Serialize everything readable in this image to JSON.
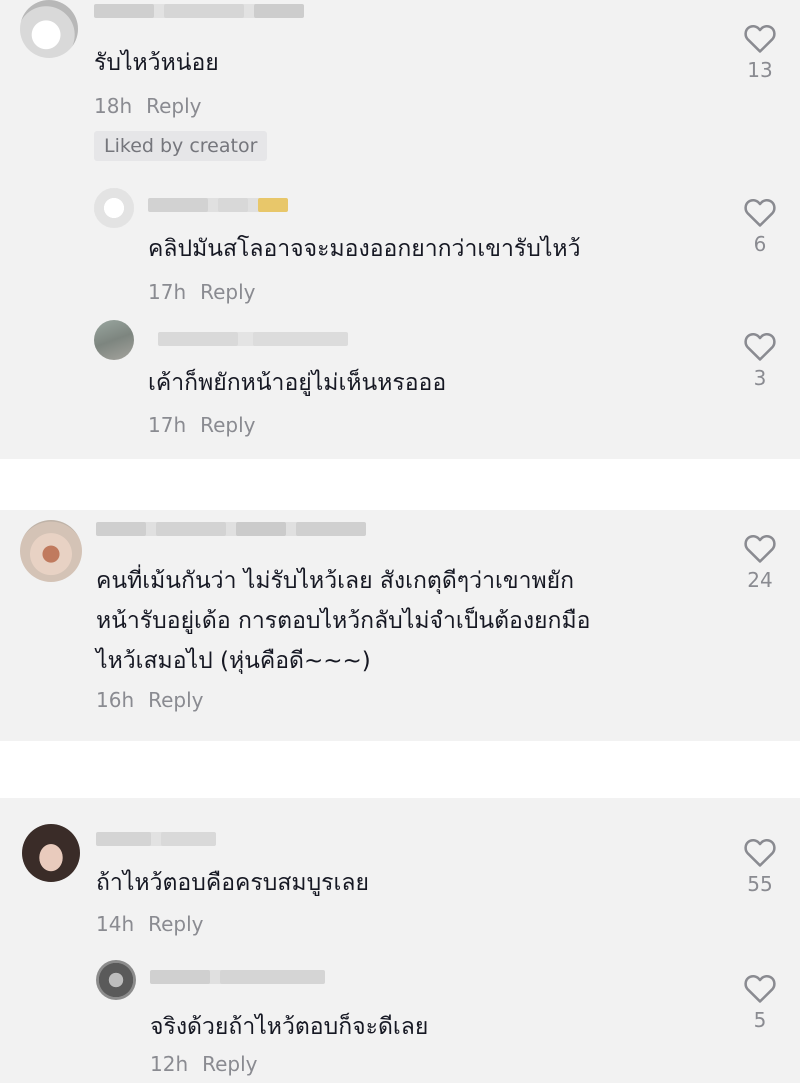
{
  "thread1": {
    "comment": {
      "text": "รับไหว้หน่อย",
      "time": "18h",
      "reply": "Reply",
      "likes": "13",
      "liked_badge": "Liked by creator"
    },
    "replies": [
      {
        "text": "คลิปมันสโลอาจจะมองออกยากว่าเขารับไหว้",
        "time": "17h",
        "reply": "Reply",
        "likes": "6"
      },
      {
        "text": "เค้าก็พยักหน้าอยู่ไม่เห็นหรอออ",
        "time": "17h",
        "reply": "Reply",
        "likes": "3"
      }
    ]
  },
  "thread2": {
    "comment": {
      "lines": [
        "คนที่เม้นกันว่า ไม่รับไหว้เลย สังเกตุดีๆว่าเขาพยัก",
        "หน้ารับอยู่เด้อ การตอบไหว้กลับไม่จำเป็นต้องยกมือ",
        "ไหว้เสมอไป (หุ่นคือดี~~~)"
      ],
      "time": "16h",
      "reply": "Reply",
      "likes": "24"
    }
  },
  "thread3": {
    "comment": {
      "text": "ถ้าไหว้ตอบคือครบสมบูรเลย",
      "time": "14h",
      "reply": "Reply",
      "likes": "55"
    },
    "replies": [
      {
        "text": "จริงด้วยถ้าไหว้ตอบก็จะดีเลย",
        "time": "12h",
        "reply": "Reply",
        "likes": "5"
      }
    ]
  },
  "icons": {
    "like": "heart-outline-icon"
  },
  "colors": {
    "panel_bg": "#f2f2f2",
    "gap_bg": "#ffffff",
    "text": "#161823",
    "muted": "#8a8b91",
    "badge_bg": "#e6e6e8"
  }
}
